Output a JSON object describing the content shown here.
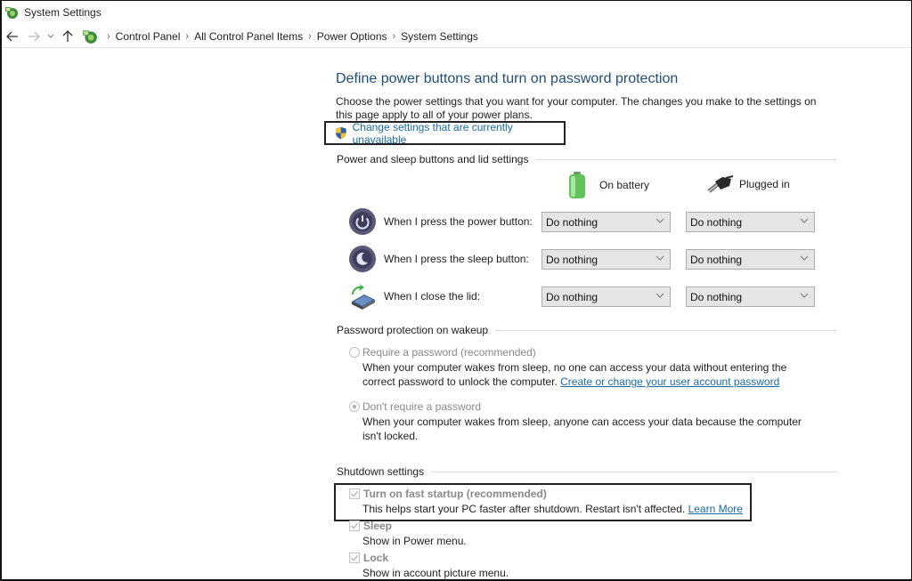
{
  "window": {
    "title": "System Settings",
    "app_icon": "control-panel-icon"
  },
  "navigation": {
    "back_icon": "arrow-left-icon",
    "forward_icon": "arrow-right-icon",
    "recent_icon": "chevron-down-icon",
    "up_icon": "arrow-up-icon",
    "breadcrumbs": [
      "Control Panel",
      "All Control Panel Items",
      "Power Options",
      "System Settings"
    ]
  },
  "page": {
    "title": "Define power buttons and turn on password protection",
    "description": "Choose the power settings that you want for your computer. The changes you make to the settings on this page apply to all of your power plans.",
    "change_settings_link": "Change settings that are currently unavailable"
  },
  "power_section": {
    "heading": "Power and sleep buttons and lid settings",
    "columns": [
      {
        "label": "On battery",
        "icon": "battery-icon"
      },
      {
        "label": "Plugged in",
        "icon": "power-plug-icon"
      }
    ],
    "rows": [
      {
        "label": "When I press the power button:",
        "icon": "power-button-icon",
        "on_battery": "Do nothing",
        "plugged_in": "Do nothing"
      },
      {
        "label": "When I press the sleep button:",
        "icon": "sleep-button-icon",
        "on_battery": "Do nothing",
        "plugged_in": "Do nothing"
      },
      {
        "label": "When I close the lid:",
        "icon": "laptop-lid-icon",
        "on_battery": "Do nothing",
        "plugged_in": "Do nothing"
      }
    ]
  },
  "password_section": {
    "heading": "Password protection on wakeup",
    "options": [
      {
        "label": "Require a password (recommended)",
        "selected": false,
        "description": "When your computer wakes from sleep, no one can access your data without entering the correct password to unlock the computer.",
        "link": "Create or change your user account password"
      },
      {
        "label": "Don't require a password",
        "selected": true,
        "description": "When your computer wakes from sleep, anyone can access your data because the computer isn't locked."
      }
    ]
  },
  "shutdown_section": {
    "heading": "Shutdown settings",
    "options": [
      {
        "label": "Turn on fast startup (recommended)",
        "checked": true,
        "description": "This helps start your PC faster after shutdown. Restart isn't affected.",
        "link": "Learn More"
      },
      {
        "label": "Sleep",
        "checked": true,
        "description": "Show in Power menu."
      },
      {
        "label": "Lock",
        "checked": true,
        "description": "Show in account picture menu."
      }
    ]
  },
  "colors": {
    "link": "#1a6aa5",
    "title": "#1f4e79",
    "disabled_text": "#8a8a8a",
    "dropdown_bg": "#e5e5e5"
  }
}
